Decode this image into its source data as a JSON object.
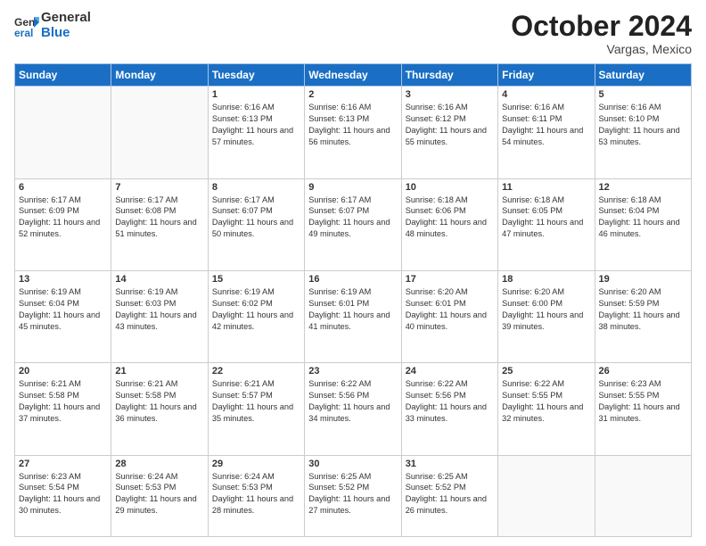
{
  "header": {
    "logo_line1": "General",
    "logo_line2": "Blue",
    "month": "October 2024",
    "location": "Vargas, Mexico"
  },
  "weekdays": [
    "Sunday",
    "Monday",
    "Tuesday",
    "Wednesday",
    "Thursday",
    "Friday",
    "Saturday"
  ],
  "weeks": [
    [
      {
        "day": "",
        "sunrise": "",
        "sunset": "",
        "daylight": ""
      },
      {
        "day": "",
        "sunrise": "",
        "sunset": "",
        "daylight": ""
      },
      {
        "day": "1",
        "sunrise": "Sunrise: 6:16 AM",
        "sunset": "Sunset: 6:13 PM",
        "daylight": "Daylight: 11 hours and 57 minutes."
      },
      {
        "day": "2",
        "sunrise": "Sunrise: 6:16 AM",
        "sunset": "Sunset: 6:13 PM",
        "daylight": "Daylight: 11 hours and 56 minutes."
      },
      {
        "day": "3",
        "sunrise": "Sunrise: 6:16 AM",
        "sunset": "Sunset: 6:12 PM",
        "daylight": "Daylight: 11 hours and 55 minutes."
      },
      {
        "day": "4",
        "sunrise": "Sunrise: 6:16 AM",
        "sunset": "Sunset: 6:11 PM",
        "daylight": "Daylight: 11 hours and 54 minutes."
      },
      {
        "day": "5",
        "sunrise": "Sunrise: 6:16 AM",
        "sunset": "Sunset: 6:10 PM",
        "daylight": "Daylight: 11 hours and 53 minutes."
      }
    ],
    [
      {
        "day": "6",
        "sunrise": "Sunrise: 6:17 AM",
        "sunset": "Sunset: 6:09 PM",
        "daylight": "Daylight: 11 hours and 52 minutes."
      },
      {
        "day": "7",
        "sunrise": "Sunrise: 6:17 AM",
        "sunset": "Sunset: 6:08 PM",
        "daylight": "Daylight: 11 hours and 51 minutes."
      },
      {
        "day": "8",
        "sunrise": "Sunrise: 6:17 AM",
        "sunset": "Sunset: 6:07 PM",
        "daylight": "Daylight: 11 hours and 50 minutes."
      },
      {
        "day": "9",
        "sunrise": "Sunrise: 6:17 AM",
        "sunset": "Sunset: 6:07 PM",
        "daylight": "Daylight: 11 hours and 49 minutes."
      },
      {
        "day": "10",
        "sunrise": "Sunrise: 6:18 AM",
        "sunset": "Sunset: 6:06 PM",
        "daylight": "Daylight: 11 hours and 48 minutes."
      },
      {
        "day": "11",
        "sunrise": "Sunrise: 6:18 AM",
        "sunset": "Sunset: 6:05 PM",
        "daylight": "Daylight: 11 hours and 47 minutes."
      },
      {
        "day": "12",
        "sunrise": "Sunrise: 6:18 AM",
        "sunset": "Sunset: 6:04 PM",
        "daylight": "Daylight: 11 hours and 46 minutes."
      }
    ],
    [
      {
        "day": "13",
        "sunrise": "Sunrise: 6:19 AM",
        "sunset": "Sunset: 6:04 PM",
        "daylight": "Daylight: 11 hours and 45 minutes."
      },
      {
        "day": "14",
        "sunrise": "Sunrise: 6:19 AM",
        "sunset": "Sunset: 6:03 PM",
        "daylight": "Daylight: 11 hours and 43 minutes."
      },
      {
        "day": "15",
        "sunrise": "Sunrise: 6:19 AM",
        "sunset": "Sunset: 6:02 PM",
        "daylight": "Daylight: 11 hours and 42 minutes."
      },
      {
        "day": "16",
        "sunrise": "Sunrise: 6:19 AM",
        "sunset": "Sunset: 6:01 PM",
        "daylight": "Daylight: 11 hours and 41 minutes."
      },
      {
        "day": "17",
        "sunrise": "Sunrise: 6:20 AM",
        "sunset": "Sunset: 6:01 PM",
        "daylight": "Daylight: 11 hours and 40 minutes."
      },
      {
        "day": "18",
        "sunrise": "Sunrise: 6:20 AM",
        "sunset": "Sunset: 6:00 PM",
        "daylight": "Daylight: 11 hours and 39 minutes."
      },
      {
        "day": "19",
        "sunrise": "Sunrise: 6:20 AM",
        "sunset": "Sunset: 5:59 PM",
        "daylight": "Daylight: 11 hours and 38 minutes."
      }
    ],
    [
      {
        "day": "20",
        "sunrise": "Sunrise: 6:21 AM",
        "sunset": "Sunset: 5:58 PM",
        "daylight": "Daylight: 11 hours and 37 minutes."
      },
      {
        "day": "21",
        "sunrise": "Sunrise: 6:21 AM",
        "sunset": "Sunset: 5:58 PM",
        "daylight": "Daylight: 11 hours and 36 minutes."
      },
      {
        "day": "22",
        "sunrise": "Sunrise: 6:21 AM",
        "sunset": "Sunset: 5:57 PM",
        "daylight": "Daylight: 11 hours and 35 minutes."
      },
      {
        "day": "23",
        "sunrise": "Sunrise: 6:22 AM",
        "sunset": "Sunset: 5:56 PM",
        "daylight": "Daylight: 11 hours and 34 minutes."
      },
      {
        "day": "24",
        "sunrise": "Sunrise: 6:22 AM",
        "sunset": "Sunset: 5:56 PM",
        "daylight": "Daylight: 11 hours and 33 minutes."
      },
      {
        "day": "25",
        "sunrise": "Sunrise: 6:22 AM",
        "sunset": "Sunset: 5:55 PM",
        "daylight": "Daylight: 11 hours and 32 minutes."
      },
      {
        "day": "26",
        "sunrise": "Sunrise: 6:23 AM",
        "sunset": "Sunset: 5:55 PM",
        "daylight": "Daylight: 11 hours and 31 minutes."
      }
    ],
    [
      {
        "day": "27",
        "sunrise": "Sunrise: 6:23 AM",
        "sunset": "Sunset: 5:54 PM",
        "daylight": "Daylight: 11 hours and 30 minutes."
      },
      {
        "day": "28",
        "sunrise": "Sunrise: 6:24 AM",
        "sunset": "Sunset: 5:53 PM",
        "daylight": "Daylight: 11 hours and 29 minutes."
      },
      {
        "day": "29",
        "sunrise": "Sunrise: 6:24 AM",
        "sunset": "Sunset: 5:53 PM",
        "daylight": "Daylight: 11 hours and 28 minutes."
      },
      {
        "day": "30",
        "sunrise": "Sunrise: 6:25 AM",
        "sunset": "Sunset: 5:52 PM",
        "daylight": "Daylight: 11 hours and 27 minutes."
      },
      {
        "day": "31",
        "sunrise": "Sunrise: 6:25 AM",
        "sunset": "Sunset: 5:52 PM",
        "daylight": "Daylight: 11 hours and 26 minutes."
      },
      {
        "day": "",
        "sunrise": "",
        "sunset": "",
        "daylight": ""
      },
      {
        "day": "",
        "sunrise": "",
        "sunset": "",
        "daylight": ""
      }
    ]
  ]
}
